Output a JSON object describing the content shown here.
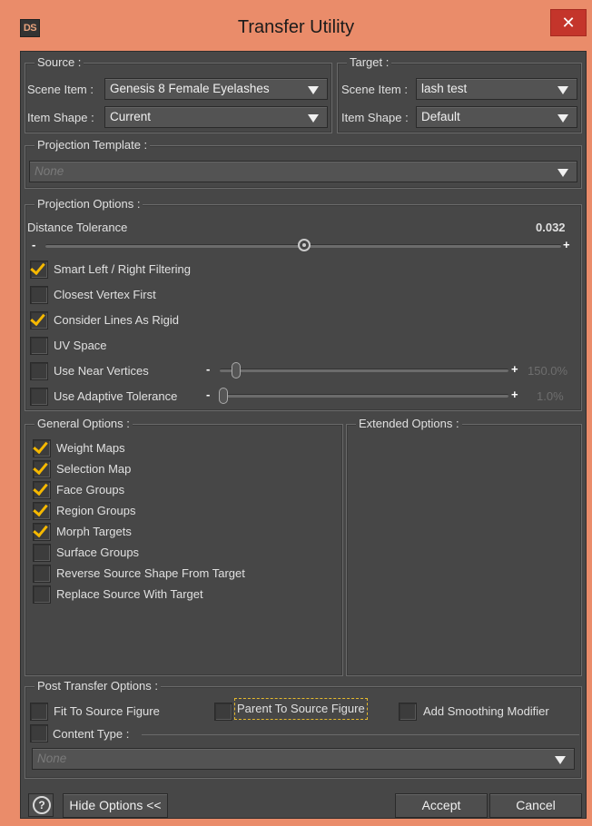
{
  "window": {
    "icon_text": "DS",
    "title": "Transfer Utility",
    "close_glyph": "✕",
    "close_icon": "close-icon",
    "accent": "#ea8c6a",
    "close_color": "#c4352b"
  },
  "source": {
    "title": "Source :",
    "scene_item_label": "Scene Item :",
    "scene_item_value": "Genesis 8 Female Eyelashes",
    "item_shape_label": "Item Shape :",
    "item_shape_value": "Current"
  },
  "target": {
    "title": "Target :",
    "scene_item_label": "Scene Item :",
    "scene_item_value": "lash test",
    "item_shape_label": "Item Shape :",
    "item_shape_value": "Default"
  },
  "projection_template": {
    "title": "Projection Template :",
    "value": "None"
  },
  "projection_options": {
    "title": "Projection Options :",
    "distance_label": "Distance Tolerance",
    "distance_value": "0.032",
    "slider_minus": "-",
    "slider_plus": "+",
    "smart_filtering": {
      "label": "Smart Left / Right Filtering",
      "checked": true
    },
    "closest_vertex": {
      "label": "Closest Vertex First",
      "checked": false
    },
    "lines_rigid": {
      "label": "Consider Lines As Rigid",
      "checked": true
    },
    "uv_space": {
      "label": "UV Space",
      "checked": false
    },
    "near_vertices": {
      "label": "Use Near Vertices",
      "checked": false,
      "value": "150.0%"
    },
    "adaptive_tolerance": {
      "label": "Use Adaptive Tolerance",
      "checked": false,
      "value": "1.0%"
    }
  },
  "general_options": {
    "title": "General Options :",
    "items": [
      {
        "label": "Weight Maps",
        "checked": true
      },
      {
        "label": "Selection Map",
        "checked": true
      },
      {
        "label": "Face Groups",
        "checked": true
      },
      {
        "label": "Region Groups",
        "checked": true
      },
      {
        "label": "Morph Targets",
        "checked": true
      },
      {
        "label": "Surface Groups",
        "checked": false
      },
      {
        "label": "Reverse Source Shape From Target",
        "checked": false
      },
      {
        "label": "Replace Source With Target",
        "checked": false
      }
    ]
  },
  "extended_options": {
    "title": "Extended Options :"
  },
  "post_transfer": {
    "title": "Post Transfer Options :",
    "fit_to_source": {
      "label": "Fit To Source Figure",
      "checked": false
    },
    "parent_to_source": {
      "label": "Parent To Source Figure",
      "checked": false
    },
    "add_smoothing": {
      "label": "Add Smoothing Modifier",
      "checked": false
    },
    "content_type": {
      "label": "Content Type :",
      "checked": false,
      "value": "None"
    }
  },
  "footer": {
    "help_glyph": "?",
    "hide_options": "Hide Options <<",
    "accept": "Accept",
    "cancel": "Cancel"
  },
  "check_color": "#f5b800"
}
